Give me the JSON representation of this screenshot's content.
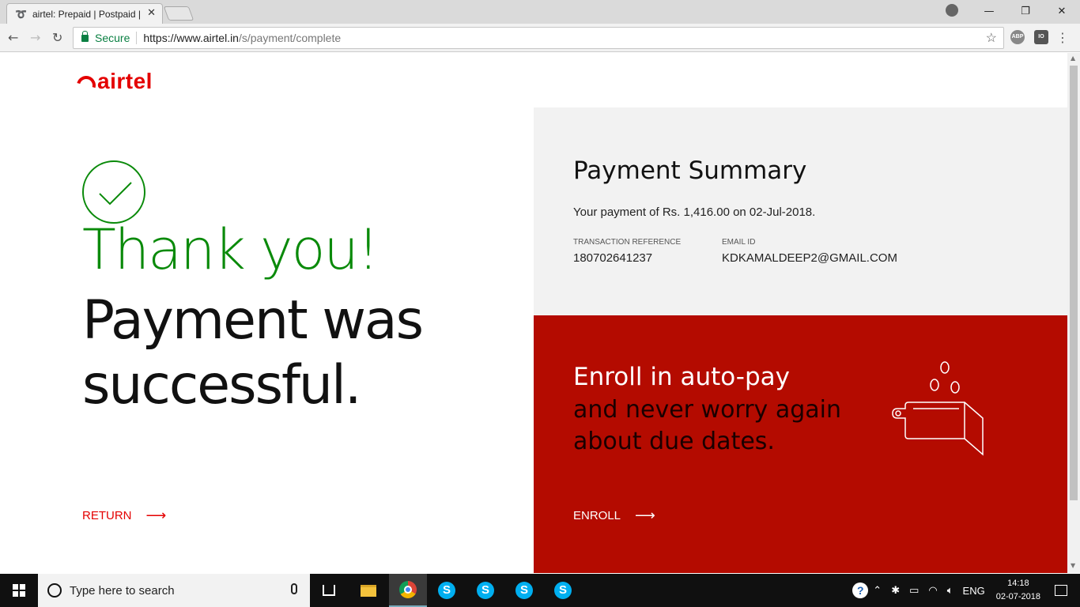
{
  "browser": {
    "tab_title": "airtel: Prepaid | Postpaid |",
    "tab_close": "✕",
    "secure_label": "Secure",
    "url_host": "https://www.airtel.in",
    "url_path": "/s/payment/complete",
    "extensions": [
      "ABP",
      "IO"
    ]
  },
  "page": {
    "logo_text": "airtel",
    "thank_you": "Thank you!",
    "success_message": "Payment was successful.",
    "return_label": "RETURN",
    "arrow": "⟶"
  },
  "summary": {
    "title": "Payment Summary",
    "line": "Your payment of Rs. 1,416.00 on 02-Jul-2018.",
    "txn_label": "TRANSACTION REFERENCE",
    "txn_value": "180702641237",
    "email_label": "EMAIL ID",
    "email_value": "KDKAMALDEEP2@GMAIL.COM"
  },
  "autopay": {
    "title": "Enroll in auto-pay",
    "subtitle": "and never worry again about due dates.",
    "enroll_label": "ENROLL"
  },
  "taskbar": {
    "search_placeholder": "Type here to search",
    "language": "ENG",
    "time": "14:18",
    "date": "02-07-2018"
  },
  "colors": {
    "brand_red": "#e40000",
    "success_green": "#0a8a0a",
    "autopay_bg": "#b40b00",
    "summary_bg": "#f2f2f2"
  },
  "icons": [
    "airtel-logo",
    "check-icon",
    "wallet-icon",
    "coins-icon",
    "arrow-right-icon",
    "star-icon",
    "lock-icon",
    "windows-icon",
    "chrome-icon",
    "skype-icon",
    "folder-icon"
  ]
}
